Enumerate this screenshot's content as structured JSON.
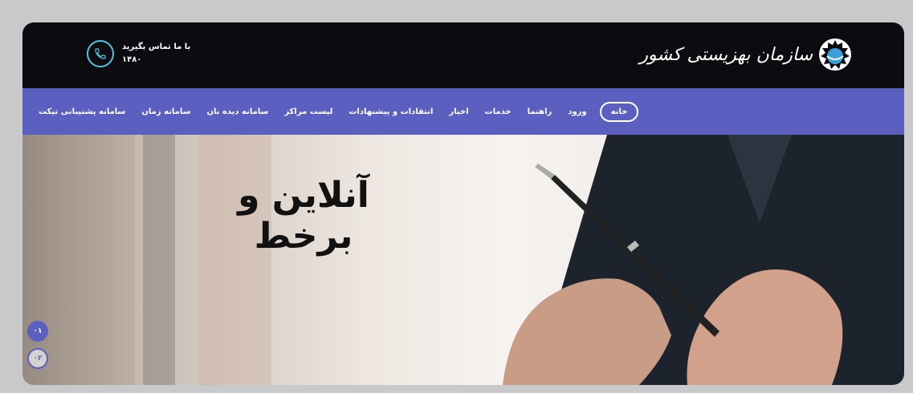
{
  "header": {
    "logo_text": "سازمان بهزیستی کشور",
    "contact_label": "با ما تماس بگیرید",
    "contact_number": "۱۴۸۰"
  },
  "nav": {
    "items": [
      {
        "label": "خانه",
        "active": true
      },
      {
        "label": "ورود"
      },
      {
        "label": "راهنما"
      },
      {
        "label": "خدمات"
      },
      {
        "label": "اخبار"
      },
      {
        "label": "انتقادات و پیشنهادات"
      },
      {
        "label": "لیست مراکز"
      },
      {
        "label": "سامانه دیده بان"
      },
      {
        "label": "سامانه زمان"
      },
      {
        "label": "سامانه پشتیبانی تیکت"
      }
    ]
  },
  "hero": {
    "title": "آنلاین و برخط",
    "slides": [
      "۰۱",
      "۰۲"
    ]
  },
  "colors": {
    "topbar": "#0c0c10",
    "navbar": "#5a5fc0",
    "accent": "#4fc6e0"
  }
}
